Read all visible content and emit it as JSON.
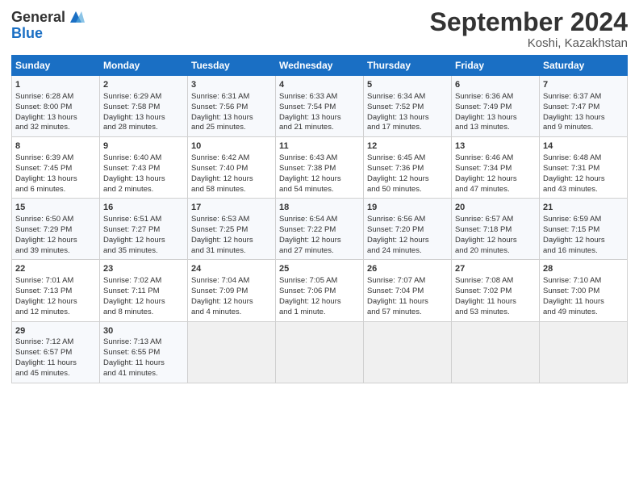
{
  "logo": {
    "general": "General",
    "blue": "Blue"
  },
  "title": "September 2024",
  "subtitle": "Koshi, Kazakhstan",
  "days_of_week": [
    "Sunday",
    "Monday",
    "Tuesday",
    "Wednesday",
    "Thursday",
    "Friday",
    "Saturday"
  ],
  "weeks": [
    [
      {
        "day": "1",
        "lines": [
          "Sunrise: 6:28 AM",
          "Sunset: 8:00 PM",
          "Daylight: 13 hours",
          "and 32 minutes."
        ]
      },
      {
        "day": "2",
        "lines": [
          "Sunrise: 6:29 AM",
          "Sunset: 7:58 PM",
          "Daylight: 13 hours",
          "and 28 minutes."
        ]
      },
      {
        "day": "3",
        "lines": [
          "Sunrise: 6:31 AM",
          "Sunset: 7:56 PM",
          "Daylight: 13 hours",
          "and 25 minutes."
        ]
      },
      {
        "day": "4",
        "lines": [
          "Sunrise: 6:33 AM",
          "Sunset: 7:54 PM",
          "Daylight: 13 hours",
          "and 21 minutes."
        ]
      },
      {
        "day": "5",
        "lines": [
          "Sunrise: 6:34 AM",
          "Sunset: 7:52 PM",
          "Daylight: 13 hours",
          "and 17 minutes."
        ]
      },
      {
        "day": "6",
        "lines": [
          "Sunrise: 6:36 AM",
          "Sunset: 7:49 PM",
          "Daylight: 13 hours",
          "and 13 minutes."
        ]
      },
      {
        "day": "7",
        "lines": [
          "Sunrise: 6:37 AM",
          "Sunset: 7:47 PM",
          "Daylight: 13 hours",
          "and 9 minutes."
        ]
      }
    ],
    [
      {
        "day": "8",
        "lines": [
          "Sunrise: 6:39 AM",
          "Sunset: 7:45 PM",
          "Daylight: 13 hours",
          "and 6 minutes."
        ]
      },
      {
        "day": "9",
        "lines": [
          "Sunrise: 6:40 AM",
          "Sunset: 7:43 PM",
          "Daylight: 13 hours",
          "and 2 minutes."
        ]
      },
      {
        "day": "10",
        "lines": [
          "Sunrise: 6:42 AM",
          "Sunset: 7:40 PM",
          "Daylight: 12 hours",
          "and 58 minutes."
        ]
      },
      {
        "day": "11",
        "lines": [
          "Sunrise: 6:43 AM",
          "Sunset: 7:38 PM",
          "Daylight: 12 hours",
          "and 54 minutes."
        ]
      },
      {
        "day": "12",
        "lines": [
          "Sunrise: 6:45 AM",
          "Sunset: 7:36 PM",
          "Daylight: 12 hours",
          "and 50 minutes."
        ]
      },
      {
        "day": "13",
        "lines": [
          "Sunrise: 6:46 AM",
          "Sunset: 7:34 PM",
          "Daylight: 12 hours",
          "and 47 minutes."
        ]
      },
      {
        "day": "14",
        "lines": [
          "Sunrise: 6:48 AM",
          "Sunset: 7:31 PM",
          "Daylight: 12 hours",
          "and 43 minutes."
        ]
      }
    ],
    [
      {
        "day": "15",
        "lines": [
          "Sunrise: 6:50 AM",
          "Sunset: 7:29 PM",
          "Daylight: 12 hours",
          "and 39 minutes."
        ]
      },
      {
        "day": "16",
        "lines": [
          "Sunrise: 6:51 AM",
          "Sunset: 7:27 PM",
          "Daylight: 12 hours",
          "and 35 minutes."
        ]
      },
      {
        "day": "17",
        "lines": [
          "Sunrise: 6:53 AM",
          "Sunset: 7:25 PM",
          "Daylight: 12 hours",
          "and 31 minutes."
        ]
      },
      {
        "day": "18",
        "lines": [
          "Sunrise: 6:54 AM",
          "Sunset: 7:22 PM",
          "Daylight: 12 hours",
          "and 27 minutes."
        ]
      },
      {
        "day": "19",
        "lines": [
          "Sunrise: 6:56 AM",
          "Sunset: 7:20 PM",
          "Daylight: 12 hours",
          "and 24 minutes."
        ]
      },
      {
        "day": "20",
        "lines": [
          "Sunrise: 6:57 AM",
          "Sunset: 7:18 PM",
          "Daylight: 12 hours",
          "and 20 minutes."
        ]
      },
      {
        "day": "21",
        "lines": [
          "Sunrise: 6:59 AM",
          "Sunset: 7:15 PM",
          "Daylight: 12 hours",
          "and 16 minutes."
        ]
      }
    ],
    [
      {
        "day": "22",
        "lines": [
          "Sunrise: 7:01 AM",
          "Sunset: 7:13 PM",
          "Daylight: 12 hours",
          "and 12 minutes."
        ]
      },
      {
        "day": "23",
        "lines": [
          "Sunrise: 7:02 AM",
          "Sunset: 7:11 PM",
          "Daylight: 12 hours",
          "and 8 minutes."
        ]
      },
      {
        "day": "24",
        "lines": [
          "Sunrise: 7:04 AM",
          "Sunset: 7:09 PM",
          "Daylight: 12 hours",
          "and 4 minutes."
        ]
      },
      {
        "day": "25",
        "lines": [
          "Sunrise: 7:05 AM",
          "Sunset: 7:06 PM",
          "Daylight: 12 hours",
          "and 1 minute."
        ]
      },
      {
        "day": "26",
        "lines": [
          "Sunrise: 7:07 AM",
          "Sunset: 7:04 PM",
          "Daylight: 11 hours",
          "and 57 minutes."
        ]
      },
      {
        "day": "27",
        "lines": [
          "Sunrise: 7:08 AM",
          "Sunset: 7:02 PM",
          "Daylight: 11 hours",
          "and 53 minutes."
        ]
      },
      {
        "day": "28",
        "lines": [
          "Sunrise: 7:10 AM",
          "Sunset: 7:00 PM",
          "Daylight: 11 hours",
          "and 49 minutes."
        ]
      }
    ],
    [
      {
        "day": "29",
        "lines": [
          "Sunrise: 7:12 AM",
          "Sunset: 6:57 PM",
          "Daylight: 11 hours",
          "and 45 minutes."
        ]
      },
      {
        "day": "30",
        "lines": [
          "Sunrise: 7:13 AM",
          "Sunset: 6:55 PM",
          "Daylight: 11 hours",
          "and 41 minutes."
        ]
      },
      {
        "day": "",
        "lines": []
      },
      {
        "day": "",
        "lines": []
      },
      {
        "day": "",
        "lines": []
      },
      {
        "day": "",
        "lines": []
      },
      {
        "day": "",
        "lines": []
      }
    ]
  ]
}
